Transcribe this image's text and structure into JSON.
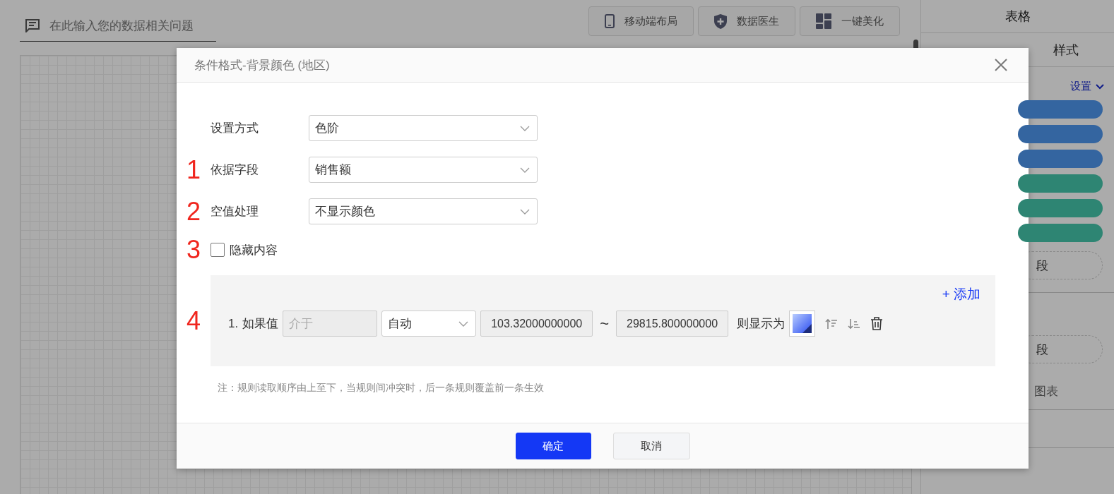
{
  "search": {
    "placeholder": "在此输入您的数据相关问题"
  },
  "toolbar": [
    {
      "label": "移动端布局",
      "kind": "phone"
    },
    {
      "label": "数据医生",
      "kind": "shield"
    },
    {
      "label": "一键美化",
      "kind": "tiles"
    }
  ],
  "right_panel": {
    "title": "表格",
    "tabs": [
      "样式"
    ],
    "settings_link": "设置",
    "fields": [
      {
        "color": "#3465a0"
      },
      {
        "color": "#3465a0"
      },
      {
        "color": "#3465a0"
      },
      {
        "color": "#2e8573"
      },
      {
        "color": "#2e8573"
      },
      {
        "color": "#2e8573"
      }
    ],
    "drop_zones": [
      "段",
      "段"
    ],
    "hint": "图表"
  },
  "dialog": {
    "title": "条件格式-背景颜色 (地区)",
    "form_rows": [
      {
        "label": "设置方式",
        "value": "色阶"
      },
      {
        "marker": "1",
        "label": "依据字段",
        "value": "销售额"
      },
      {
        "marker": "2",
        "label": "空值处理",
        "value": "不显示颜色"
      }
    ],
    "checkbox": {
      "marker": "3",
      "label": "隐藏内容",
      "checked": false
    },
    "rules": {
      "marker": "4",
      "add": "+ 添加",
      "items": [
        {
          "index": "1.",
          "condition_label": "如果值",
          "operator": "介于",
          "mode": "自动",
          "min": "103.32000000000",
          "separator": "~",
          "max": "29815.800000000",
          "then_label": "则显示为"
        }
      ]
    },
    "note": "注：规则读取顺序由上至下，当规则间冲突时，后一条规则覆盖前一条生效",
    "buttons": [
      {
        "label": "确定",
        "kind": "primary"
      },
      {
        "label": "取消",
        "kind": "default"
      }
    ]
  }
}
